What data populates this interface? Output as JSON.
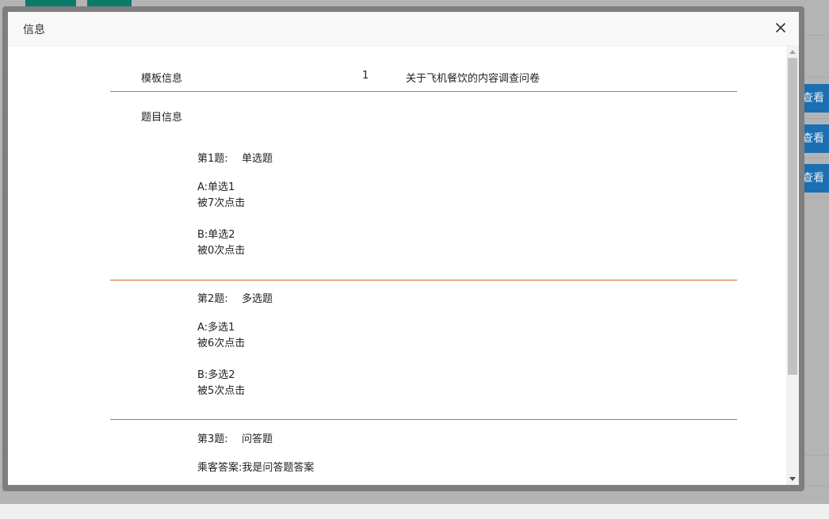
{
  "background": {
    "view_buttons": [
      "查看",
      "查看",
      "查看"
    ]
  },
  "dialog": {
    "title": "信息",
    "close_icon": "close-icon"
  },
  "template": {
    "label": "模板信息",
    "id": "1",
    "name": "关于飞机餐饮的内容调查问卷"
  },
  "questions_label": "题目信息",
  "questions": [
    {
      "number": "第1题:",
      "type": "单选题",
      "options": [
        {
          "label": "A:单选1",
          "clicks": "被7次点击"
        },
        {
          "label": "B:单选2",
          "clicks": "被0次点击"
        }
      ]
    },
    {
      "number": "第2题:",
      "type": "多选题",
      "options": [
        {
          "label": "A:多选1",
          "clicks": "被6次点击"
        },
        {
          "label": "B:多选2",
          "clicks": "被5次点击"
        }
      ]
    },
    {
      "number": "第3题:",
      "type": "问答题",
      "answer": "乘客答案:我是问答题答案"
    }
  ],
  "colors": {
    "separator": "#e0652c",
    "view_button": "#1c6fb0",
    "top_button": "#0a7a6a"
  }
}
